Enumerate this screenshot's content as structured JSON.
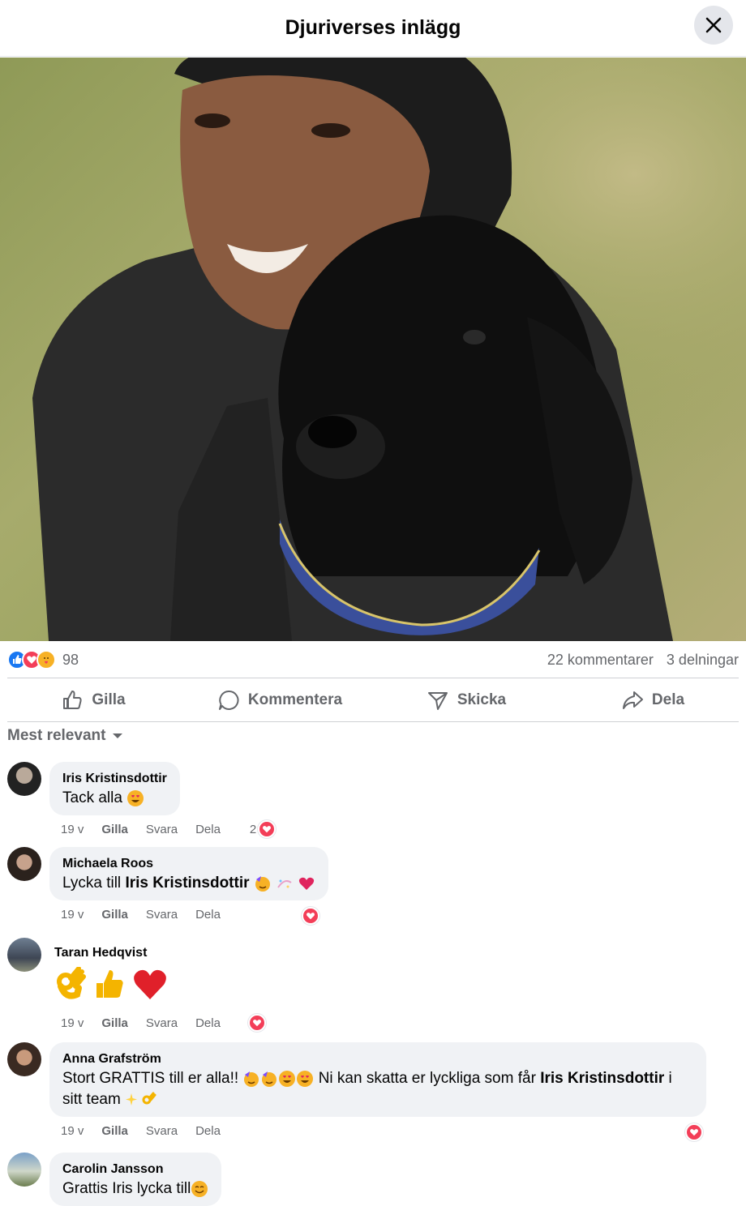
{
  "header": {
    "title": "Djuriverses inlägg"
  },
  "stats": {
    "reaction_count": "98",
    "comments": "22 kommentarer",
    "shares": "3 delningar"
  },
  "actions": {
    "like": "Gilla",
    "comment": "Kommentera",
    "send": "Skicka",
    "share": "Dela"
  },
  "sort": {
    "label": "Mest relevant"
  },
  "comments": [
    {
      "author": "Iris Kristinsdottir",
      "text": "Tack alla",
      "time": "19 v",
      "like": "Gilla",
      "reply": "Svara",
      "share": "Dela",
      "reactions": "2"
    },
    {
      "author": "Michaela Roos",
      "text_prefix": "Lycka till",
      "mention": "Iris Kristinsdottir",
      "time": "19 v",
      "like": "Gilla",
      "reply": "Svara",
      "share": "Dela"
    },
    {
      "author": "Taran Hedqvist",
      "time": "19 v",
      "like": "Gilla",
      "reply": "Svara",
      "share": "Dela"
    },
    {
      "author": "Anna Grafström",
      "text_a": "Stort GRATTIS till er alla!!",
      "text_b": "Ni kan skatta er lyckliga som får",
      "mention": "Iris Kristinsdottir",
      "text_c": "i",
      "text_d": "sitt team",
      "time": "19 v",
      "like": "Gilla",
      "reply": "Svara",
      "share": "Dela"
    },
    {
      "author": "Carolin Jansson",
      "text": "Grattis Iris lycka till"
    }
  ]
}
